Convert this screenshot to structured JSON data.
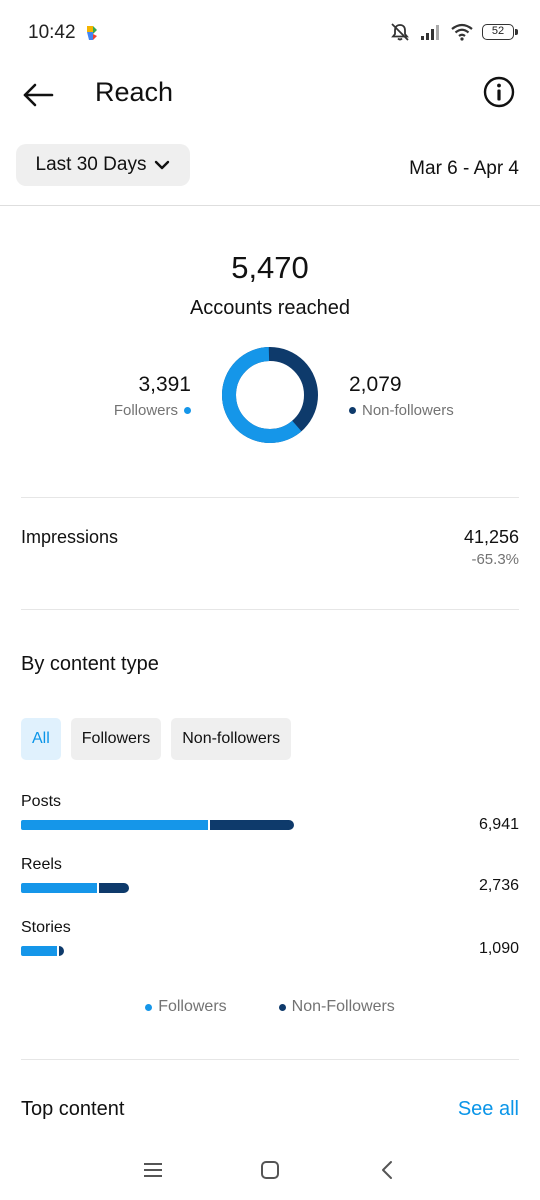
{
  "status_bar": {
    "time": "10:42",
    "battery": "52"
  },
  "header": {
    "title": "Reach",
    "back_icon": "arrow-left-icon",
    "info_icon": "info-circle-icon"
  },
  "filter": {
    "period_label": "Last 30 Days",
    "date_range": "Mar 6 - Apr 4"
  },
  "reach": {
    "total": "5,470",
    "label": "Accounts reached",
    "followers_value": "3,391",
    "followers_label": "Followers",
    "nonfollowers_value": "2,079",
    "nonfollowers_label": "Non-followers",
    "followers_fraction": 0.62
  },
  "impressions": {
    "label": "Impressions",
    "value": "41,256",
    "change": "-65.3%"
  },
  "by_content_type": {
    "title": "By content type",
    "filters": [
      "All",
      "Followers",
      "Non-followers"
    ],
    "active_filter": "All",
    "items": [
      {
        "label": "Posts",
        "value": "6,941",
        "total": 6941,
        "followers_fraction": 0.69
      },
      {
        "label": "Reels",
        "value": "2,736",
        "total": 2736,
        "followers_fraction": 0.72
      },
      {
        "label": "Stories",
        "value": "1,090",
        "total": 1090,
        "followers_fraction": 0.87
      }
    ],
    "legend": {
      "followers": "Followers",
      "nonfollowers": "Non-Followers"
    }
  },
  "top_content": {
    "title": "Top content",
    "see_all": "See all"
  },
  "colors": {
    "followers": "#1596e9",
    "nonfollowers": "#0e3a6b",
    "link": "#0a95e8"
  }
}
